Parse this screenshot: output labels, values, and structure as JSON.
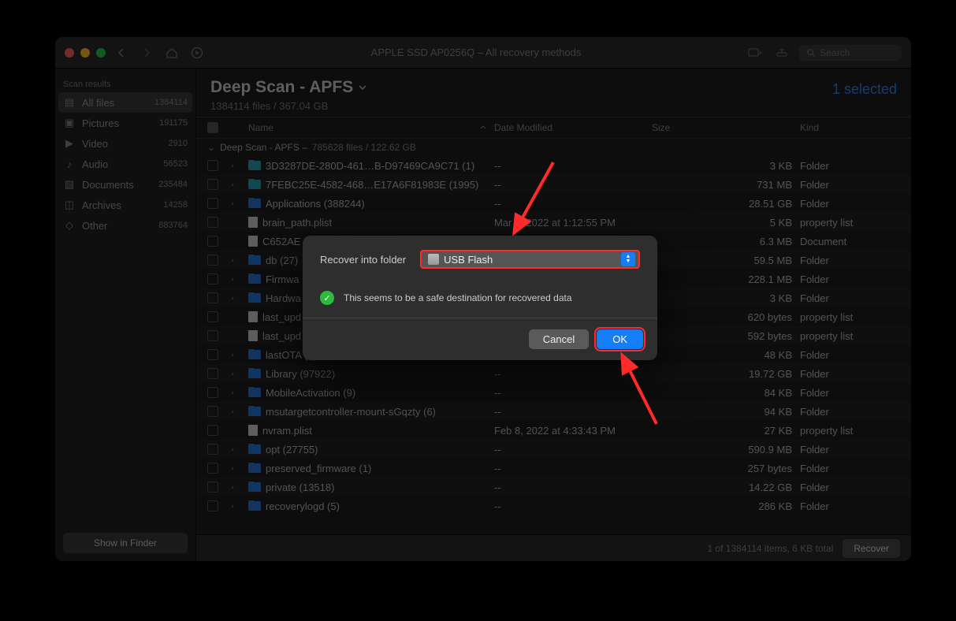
{
  "titlebar": {
    "title": "APPLE SSD AP0256Q – All recovery methods",
    "search_placeholder": "Search"
  },
  "sidebar": {
    "title": "Scan results",
    "items": [
      {
        "label": "All files",
        "count": "1384114"
      },
      {
        "label": "Pictures",
        "count": "191175"
      },
      {
        "label": "Video",
        "count": "2910"
      },
      {
        "label": "Audio",
        "count": "56523"
      },
      {
        "label": "Documents",
        "count": "235484"
      },
      {
        "label": "Archives",
        "count": "14258"
      },
      {
        "label": "Other",
        "count": "883764"
      }
    ],
    "footer_button": "Show in Finder"
  },
  "main": {
    "title": "Deep Scan - APFS",
    "subtitle": "1384114 files / 367.04 GB",
    "selected": "1 selected",
    "columns": {
      "name": "Name",
      "date": "Date Modified",
      "size": "Size",
      "kind": "Kind"
    },
    "group": {
      "label": "Deep Scan - APFS – ",
      "detail": "785628 files / 122.62 GB"
    },
    "rows": [
      {
        "disclose": true,
        "icon": "folder-cyan",
        "name": "3D3287DE-280D-461…B-D97469CA9C71 (1)",
        "date": "--",
        "size": "3 KB",
        "kind": "Folder"
      },
      {
        "disclose": true,
        "icon": "folder-cyan",
        "name": "7FEBC25E-4582-468…E17A6F81983E (1995)",
        "date": "--",
        "size": "731 MB",
        "kind": "Folder"
      },
      {
        "disclose": true,
        "icon": "folder-blue",
        "name": "Applications (388244)",
        "date": "--",
        "size": "28.51 GB",
        "kind": "Folder"
      },
      {
        "disclose": false,
        "icon": "file-white",
        "name": "brain_path.plist",
        "date": "Mar 8, 2022 at 1:12:55 PM",
        "size": "5 KB",
        "kind": "property list"
      },
      {
        "disclose": false,
        "icon": "file-white",
        "name": "C652AE",
        "date": "",
        "size": "6.3 MB",
        "kind": "Document"
      },
      {
        "disclose": true,
        "icon": "folder-blue",
        "name": "db (27)",
        "date": "",
        "size": "59.5 MB",
        "kind": "Folder"
      },
      {
        "disclose": true,
        "icon": "folder-blue",
        "name": "Firmwa",
        "date": "",
        "size": "228.1 MB",
        "kind": "Folder"
      },
      {
        "disclose": true,
        "icon": "folder-blue",
        "name": "Hardwa",
        "date": "",
        "size": "3 KB",
        "kind": "Folder"
      },
      {
        "disclose": false,
        "icon": "file-white",
        "name": "last_upd",
        "date": "",
        "size": "620 bytes",
        "kind": "property list"
      },
      {
        "disclose": false,
        "icon": "file-white",
        "name": "last_upd",
        "date": "",
        "size": "592 bytes",
        "kind": "property list"
      },
      {
        "disclose": true,
        "icon": "folder-blue",
        "name": "lastOTA (3)",
        "date": "--",
        "size": "48 KB",
        "kind": "Folder"
      },
      {
        "disclose": true,
        "icon": "folder-blue",
        "name": "Library (97922)",
        "date": "--",
        "size": "19.72 GB",
        "kind": "Folder"
      },
      {
        "disclose": true,
        "icon": "folder-blue",
        "name": "MobileActivation (9)",
        "date": "--",
        "size": "84 KB",
        "kind": "Folder"
      },
      {
        "disclose": true,
        "icon": "folder-blue",
        "name": "msutargetcontroller-mount-sGqzty (6)",
        "date": "--",
        "size": "94 KB",
        "kind": "Folder"
      },
      {
        "disclose": false,
        "icon": "file-white",
        "name": "nvram.plist",
        "date": "Feb 8, 2022 at 4:33:43 PM",
        "size": "27 KB",
        "kind": "property list"
      },
      {
        "disclose": true,
        "icon": "folder-blue",
        "name": "opt (27755)",
        "date": "--",
        "size": "590.9 MB",
        "kind": "Folder"
      },
      {
        "disclose": true,
        "icon": "folder-blue",
        "name": "preserved_firmware (1)",
        "date": "--",
        "size": "257 bytes",
        "kind": "Folder"
      },
      {
        "disclose": true,
        "icon": "folder-blue",
        "name": "private (13518)",
        "date": "--",
        "size": "14.22 GB",
        "kind": "Folder"
      },
      {
        "disclose": true,
        "icon": "folder-blue",
        "name": "recoverylogd (5)",
        "date": "--",
        "size": "286 KB",
        "kind": "Folder"
      }
    ],
    "statusbar": "1 of 1384114 items, 6 KB total",
    "recover_label": "Recover"
  },
  "modal": {
    "label": "Recover into folder",
    "destination": "USB Flash",
    "message": "This seems to be a safe destination for recovered data",
    "cancel": "Cancel",
    "ok": "OK"
  }
}
